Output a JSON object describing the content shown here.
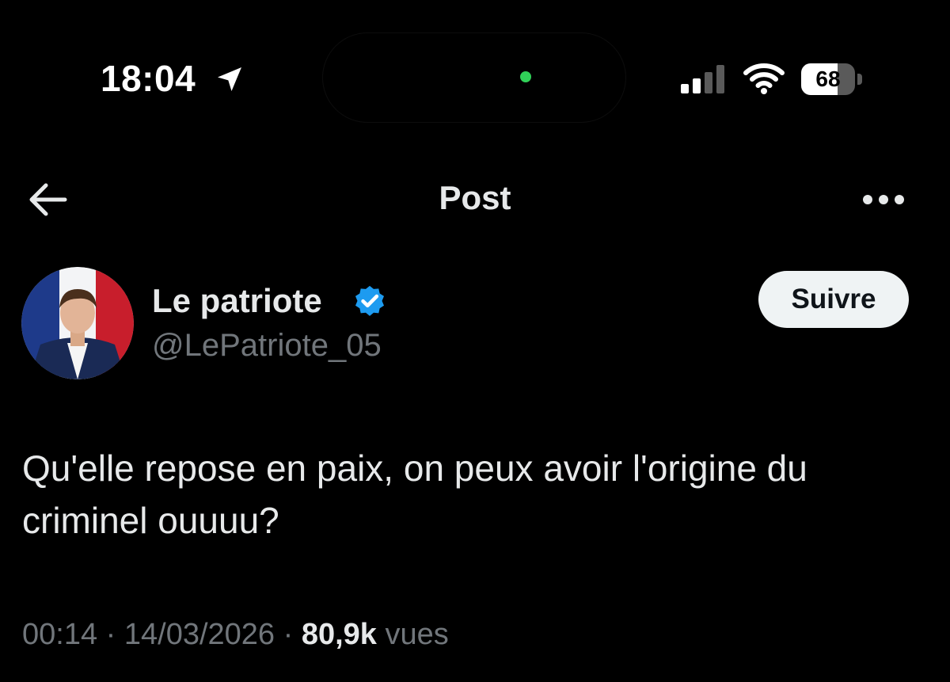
{
  "status_bar": {
    "time": "18:04",
    "battery_level": "68",
    "battery_fraction": 0.68,
    "icons": [
      "location-arrow-icon",
      "signal-icon",
      "wifi-icon",
      "battery-icon"
    ],
    "indicator_color": "#30d158"
  },
  "header": {
    "title": "Post",
    "back_icon": "arrow-left-icon",
    "more_icon": "ellipsis-icon"
  },
  "author": {
    "display_name": "Le patriote",
    "handle": "@LePatriote_05",
    "verified": true,
    "verified_color": "#1d9bf0",
    "follow_label": "Suivre"
  },
  "post": {
    "text": "Qu'elle repose en paix, on peux avoir l'origine du criminel ouuuu?",
    "time": "00:14",
    "date": "14/03/2026",
    "separator": "·",
    "views_count": "80,9k",
    "views_label": "vues"
  },
  "colors": {
    "background": "#000000",
    "primary_text": "#e7e9ea",
    "secondary_text": "#71767b",
    "button_bg": "#eff3f4"
  }
}
